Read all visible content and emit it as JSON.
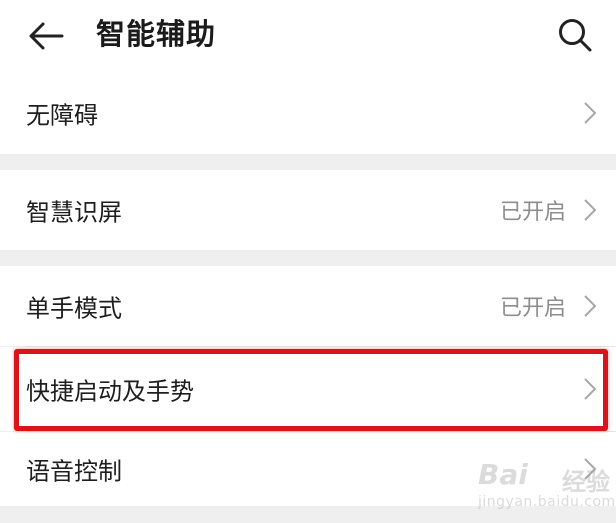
{
  "header": {
    "title": "智能辅助",
    "back_icon": "arrow-left-icon",
    "search_icon": "search-icon"
  },
  "settings": [
    {
      "label": "无障碍",
      "value": ""
    },
    {
      "label": "智慧识屏",
      "value": "已开启"
    },
    {
      "label": "单手模式",
      "value": "已开启"
    },
    {
      "label": "快捷启动及手势",
      "value": ""
    },
    {
      "label": "语音控制",
      "value": ""
    }
  ],
  "highlighted_item": "快捷启动及手势",
  "colors": {
    "highlight": "#d8141c",
    "background": "#efefef",
    "card": "#ffffff",
    "secondary_text": "#8d8d8d"
  },
  "watermark": {
    "brand": "Bai",
    "brand_cn": "经验",
    "site": "jingyan.baidu.com"
  }
}
